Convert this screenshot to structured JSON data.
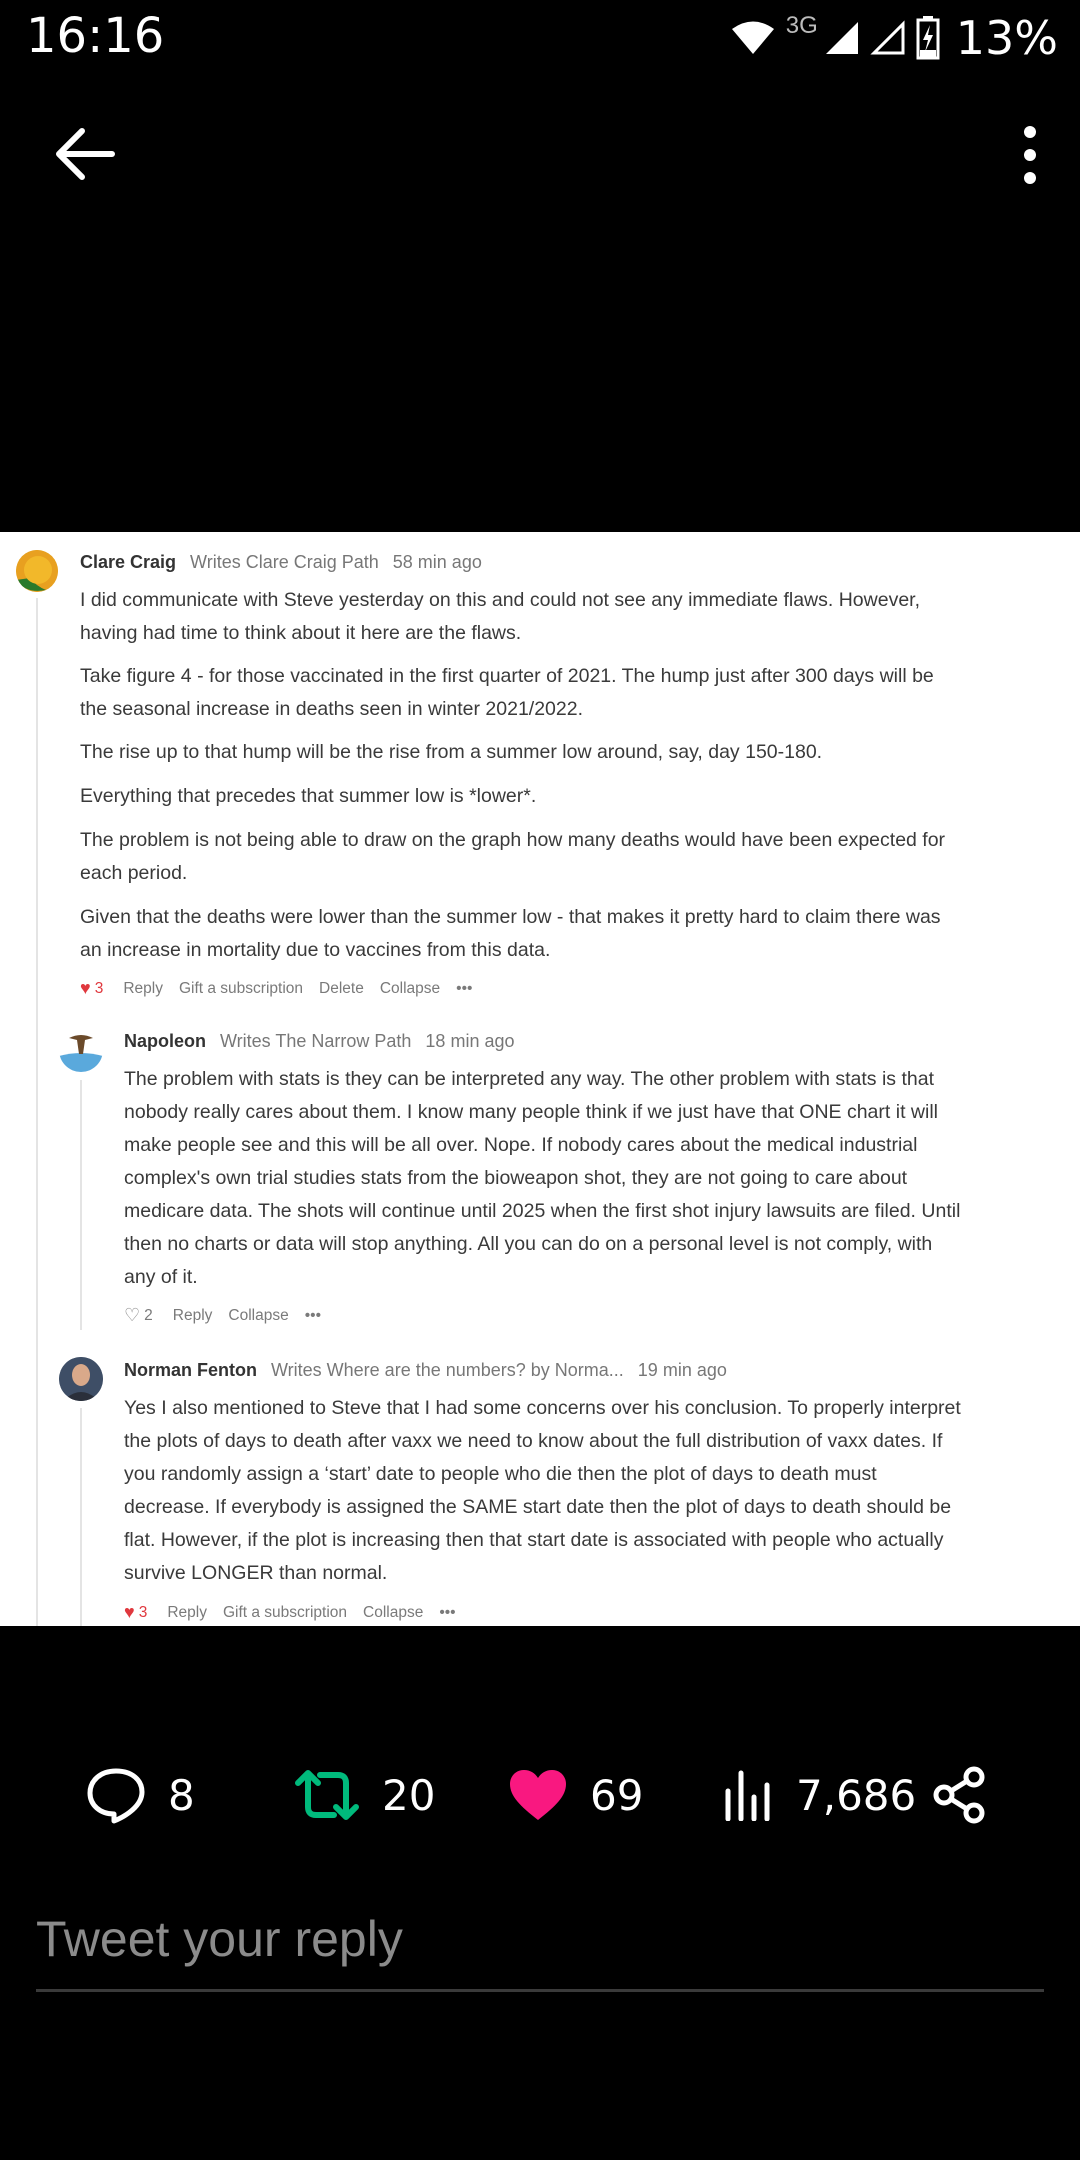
{
  "status_bar": {
    "time": "16:16",
    "network": "3G",
    "battery": "13%",
    "icons": [
      "wifi-icon",
      "signal-icon",
      "signal-empty-icon",
      "battery-charging-icon"
    ]
  },
  "top_bar": {
    "back_icon": "arrow-left-icon",
    "more_icon": "more-vertical-icon"
  },
  "comments": [
    {
      "name": "Clare Craig",
      "writes": "Writes Clare Craig Path",
      "time": "58 min ago",
      "paragraphs": [
        [
          "I did communicate with Steve yesterday on this and could not see any immediate flaws. However,",
          "having had time to think about it here are the flaws."
        ],
        [
          "Take figure 4 - for those vaccinated in the first quarter of 2021. The hump just after 300 days will be",
          "the seasonal increase in deaths seen in winter 2021/2022."
        ],
        [
          "The rise up to that hump will be the rise from a summer low around, say, day 150-180."
        ],
        [
          "Everything that precedes that summer low is *lower*."
        ],
        [
          "The problem is not being able to draw on the graph how many deaths would have been expected for",
          "each period."
        ],
        [
          "Given that the deaths were lower than the summer low - that makes it pretty hard to claim there was",
          "an increase in mortality due to vaccines from this data."
        ]
      ],
      "likes": "3",
      "actions": [
        "Reply",
        "Gift a subscription",
        "Delete",
        "Collapse",
        "•••"
      ]
    },
    {
      "name": "Napoleon",
      "writes": "Writes The Narrow Path",
      "time": "18 min ago",
      "paragraphs": [
        [
          "The problem with stats is they can be interpreted any way. The other problem with stats is that",
          "nobody really cares about them. I know many people think if we just have that ONE chart it will",
          "make people see and this will be all over. Nope. If nobody cares about the medical industrial",
          "complex's own trial studies stats from the bioweapon shot, they are not going to care about",
          "medicare data. The shots will continue until 2025 when the first shot injury lawsuits are filed. Until",
          "then no charts or data will stop anything. All you can do on a personal level is not comply, with",
          "any of it."
        ]
      ],
      "likes": "2",
      "actions": [
        "Reply",
        "Collapse",
        "•••"
      ]
    },
    {
      "name": "Norman Fenton",
      "writes": "Writes Where are the numbers? by Norma...",
      "time": "19 min ago",
      "paragraphs": [
        [
          "Yes I also mentioned to Steve that I had some concerns over his conclusion. To properly interpret",
          "the plots of days to death after vaxx we need to know about the full distribution of vaxx dates. If",
          "you randomly assign a ‘start’ date to people who die then the plot of days to death must",
          "decrease. If everybody is assigned the SAME start date then the plot of days to death should be",
          "flat. However, if the plot is increasing then that start date is associated with people who actually",
          "survive LONGER than normal."
        ]
      ],
      "likes": "3",
      "actions": [
        "Reply",
        "Gift a subscription",
        "Collapse",
        "•••"
      ]
    }
  ],
  "engagement": {
    "replies": "8",
    "retweets": "20",
    "likes": "69",
    "views": "7,686",
    "colors": {
      "retweet": "#00ba7c",
      "like": "#f91880"
    }
  },
  "reply": {
    "placeholder": "Tweet your reply"
  }
}
